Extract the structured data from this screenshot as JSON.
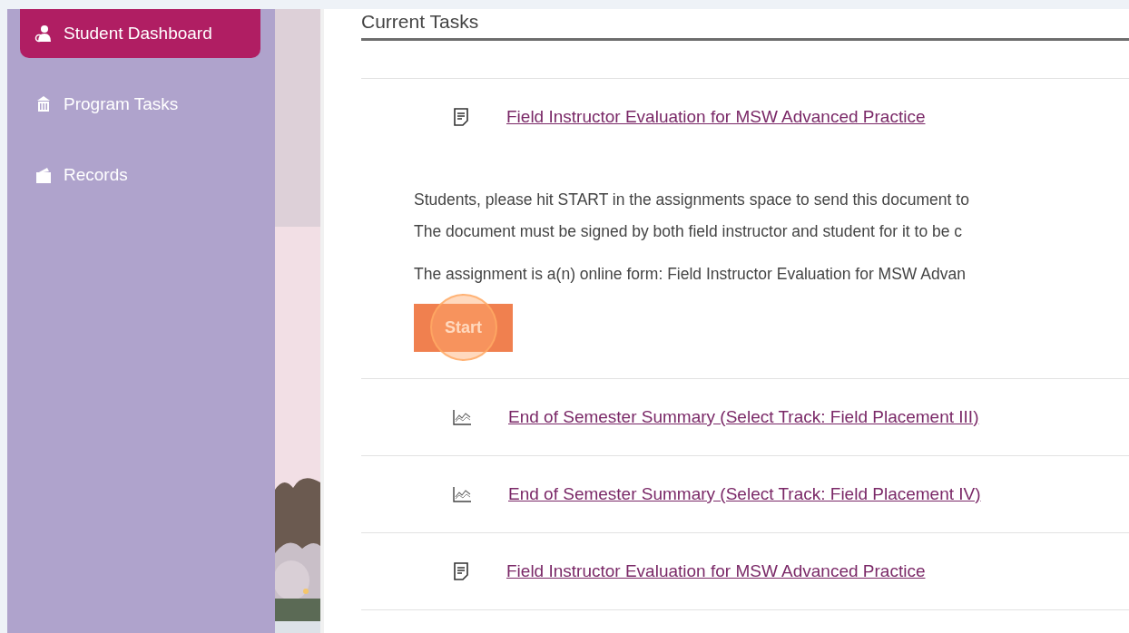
{
  "sidebar": {
    "items": [
      {
        "label": "Student Dashboard",
        "selected": true
      },
      {
        "label": "Program Tasks",
        "selected": false
      },
      {
        "label": "Records",
        "selected": false
      }
    ]
  },
  "section_title": "Current Tasks",
  "tasks": [
    {
      "kind": "form",
      "title": "Field Instructor Evaluation for MSW Advanced Practice",
      "expanded": true,
      "description": [
        "Students, please hit START in the assignments space to send this document to",
        "The document must be signed by both field instructor and student for it to be c"
      ],
      "note": "The assignment is a(n) online form: Field Instructor Evaluation for MSW Advan",
      "button": "Start",
      "highlighted": true
    },
    {
      "kind": "chart",
      "title": "End of Semester Summary (Select Track: Field Placement III)",
      "expanded": false
    },
    {
      "kind": "chart",
      "title": "End of Semester Summary (Select Track: Field Placement IV)",
      "expanded": false
    },
    {
      "kind": "form",
      "title": "Field Instructor Evaluation for MSW Advanced Practice",
      "expanded": false
    }
  ]
}
